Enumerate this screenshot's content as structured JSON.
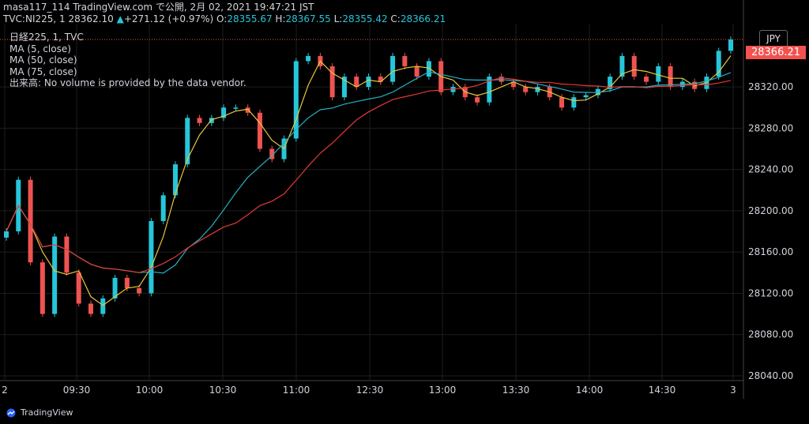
{
  "header": {
    "line1": "masa117_114 TradingView.com で公開, 2月 02, 2021 19:47:21 JST",
    "symbol": "TVC:NI225, 1",
    "price": "28362.10",
    "change": "+271.12 (+0.97%)",
    "o_label": "O:",
    "o_value": "28355.67",
    "h_label": "H:",
    "h_value": "28367.55",
    "l_label": "L:",
    "l_value": "28355.42",
    "c_label": "C:",
    "c_value": "28366.21"
  },
  "legend": {
    "title": "日経225, 1, TVC",
    "ma5": "MA (5, close)",
    "ma50": "MA (50, close)",
    "ma75": "MA (75, close)",
    "volume": "出来高: No volume is provided by the data vendor."
  },
  "currency": "JPY",
  "last_price_label": "28366.21",
  "footer": {
    "brand": "TradingView"
  },
  "colors": {
    "up": "#26c6da",
    "down": "#ef5350",
    "ma5": "#e8c53a",
    "ma50": "#26b0c4",
    "ma75": "#e53935",
    "background": "#000000",
    "grid": "#1e1e1e"
  },
  "chart_data": {
    "type": "line",
    "title": "",
    "ylabel": "",
    "xlabel": "",
    "y_ticks": [
      "28040.00",
      "28080.00",
      "28120.00",
      "28160.00",
      "28200.00",
      "28240.00",
      "28280.00",
      "28320.00"
    ],
    "x_ticks": [
      "2",
      "09:30",
      "10:00",
      "10:30",
      "11:00",
      "12:30",
      "13:00",
      "13:30",
      "14:00",
      "14:30",
      "3"
    ],
    "ylim": [
      28040,
      28366
    ],
    "grid": true,
    "series": [
      {
        "name": "日経225",
        "x": [
          "09:00",
          "09:05",
          "09:10",
          "09:15",
          "09:20",
          "09:25",
          "09:30",
          "09:35",
          "09:40",
          "09:45",
          "09:50",
          "09:55",
          "10:00",
          "10:05",
          "10:10",
          "10:15",
          "10:20",
          "10:25",
          "10:30",
          "10:35",
          "10:40",
          "10:45",
          "10:50",
          "10:55",
          "11:00",
          "11:05",
          "11:10",
          "11:15",
          "11:20",
          "11:25",
          "11:30",
          "12:35",
          "12:40",
          "12:45",
          "12:50",
          "12:55",
          "13:00",
          "13:05",
          "13:10",
          "13:15",
          "13:20",
          "13:25",
          "13:30",
          "13:35",
          "13:40",
          "13:45",
          "13:50",
          "13:55",
          "14:00",
          "14:05",
          "14:10",
          "14:15",
          "14:20",
          "14:25",
          "14:30",
          "14:35",
          "14:40",
          "14:45",
          "14:50",
          "14:55",
          "15:00"
        ],
        "values": [
          28180,
          28230,
          28150,
          28100,
          28175,
          28140,
          28110,
          28100,
          28115,
          28135,
          28125,
          28120,
          28190,
          28215,
          28245,
          28290,
          28285,
          28290,
          28300,
          28300,
          28295,
          28260,
          28250,
          28270,
          28345,
          28350,
          28340,
          28310,
          28330,
          28320,
          28330,
          28325,
          28350,
          28340,
          28330,
          28345,
          28315,
          28320,
          28310,
          28305,
          28330,
          28325,
          28320,
          28315,
          28320,
          28310,
          28300,
          28310,
          28312,
          28318,
          28330,
          28350,
          28330,
          28325,
          28340,
          28320,
          28325,
          28318,
          28330,
          28355,
          28366
        ]
      }
    ]
  }
}
